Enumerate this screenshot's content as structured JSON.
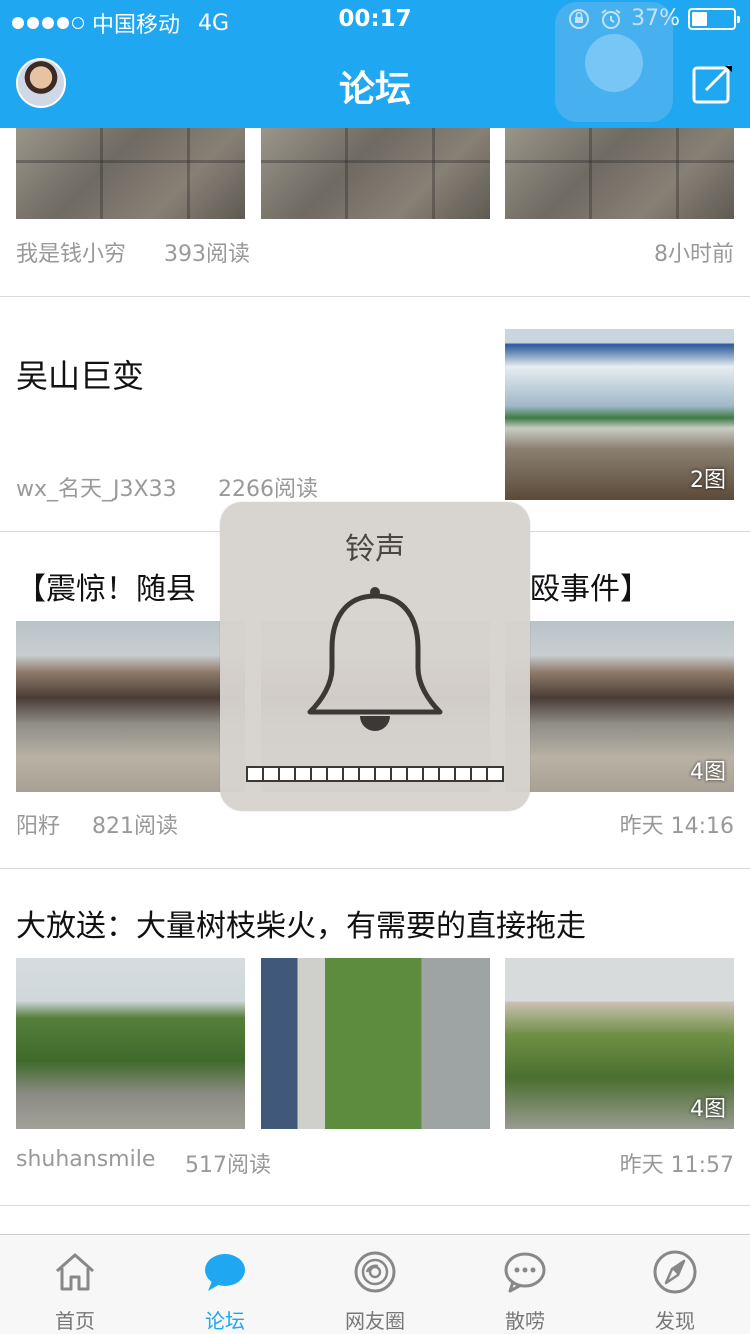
{
  "status_bar": {
    "carrier": "中国移动",
    "network": "4G",
    "time": "00:17",
    "battery_percent": "37%",
    "battery_level": 0.37
  },
  "nav": {
    "title": "论坛"
  },
  "posts": [
    {
      "author": "我是钱小穷",
      "reads": "393阅读",
      "time": "8小时前"
    },
    {
      "title": "吴山巨变",
      "author": "wx_名天_J3X33",
      "reads": "2266阅读",
      "image_count": "2图"
    },
    {
      "title": "【震惊！随县",
      "title_tail": "殴事件】",
      "author": "阳籽",
      "reads": "821阅读",
      "time": "昨天 14:16",
      "image_count": "4图"
    },
    {
      "title": "大放送：大量树枝柴火，有需要的直接拖走",
      "author": "shuhansmile",
      "reads": "517阅读",
      "time": "昨天 11:57",
      "image_count": "4图"
    }
  ],
  "ringer": {
    "title": "铃声",
    "volume_segments": 16
  },
  "tabs": [
    {
      "label": "首页",
      "icon": "home-icon"
    },
    {
      "label": "论坛",
      "icon": "chat-bubble-icon"
    },
    {
      "label": "网友圈",
      "icon": "eye-circle-icon"
    },
    {
      "label": "散唠",
      "icon": "ellipsis-bubble-icon"
    },
    {
      "label": "发现",
      "icon": "compass-icon"
    }
  ],
  "colors": {
    "accent": "#1fa7f1",
    "meta_text": "#999999",
    "tab_inactive": "#777777"
  }
}
